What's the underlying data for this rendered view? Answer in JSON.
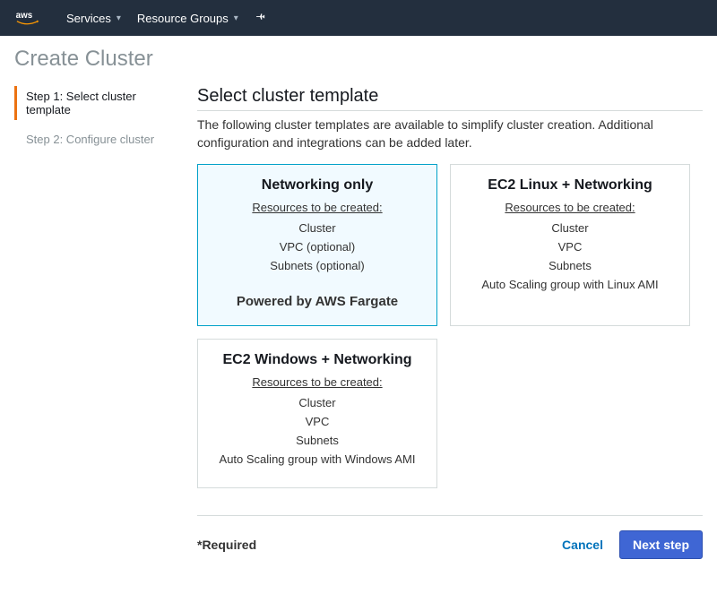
{
  "nav": {
    "services": "Services",
    "resource_groups": "Resource Groups"
  },
  "page_title": "Create Cluster",
  "steps": {
    "step1": "Step 1: Select cluster template",
    "step2": "Step 2: Configure cluster"
  },
  "section": {
    "title": "Select cluster template",
    "desc": "The following cluster templates are available to simplify cluster creation. Additional configuration and integrations can be added later."
  },
  "resources_label": "Resources to be created:",
  "cards": {
    "fargate": {
      "title": "Networking only",
      "r1": "Cluster",
      "r2": "VPC (optional)",
      "r3": "Subnets (optional)",
      "footer": "Powered by AWS Fargate"
    },
    "ec2linux": {
      "title": "EC2 Linux + Networking",
      "r1": "Cluster",
      "r2": "VPC",
      "r3": "Subnets",
      "r4": "Auto Scaling group with Linux AMI"
    },
    "ec2win": {
      "title": "EC2 Windows + Networking",
      "r1": "Cluster",
      "r2": "VPC",
      "r3": "Subnets",
      "r4": "Auto Scaling group with Windows AMI"
    }
  },
  "footer": {
    "required": "*Required",
    "cancel": "Cancel",
    "next": "Next step"
  }
}
